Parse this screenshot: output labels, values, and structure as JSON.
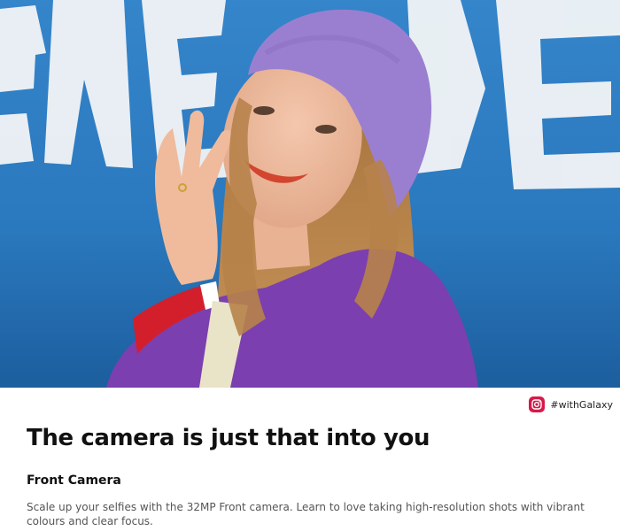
{
  "hero": {
    "image_description_icon": "selfie-photo",
    "colors": {
      "wall": "#2a78bd",
      "beret": "#9a7fd0",
      "sweater": "#7b3fb0",
      "cuff": "#d31f2b"
    }
  },
  "tag": {
    "icon": "instagram-icon",
    "handle": "#withGalaxy",
    "color": "#d9184a"
  },
  "content": {
    "headline": "The camera is just that into you",
    "subheading": "Front Camera",
    "body": "Scale up your selfies with the 32MP Front camera. Learn to love taking high-resolution shots with vibrant colours and clear focus."
  }
}
